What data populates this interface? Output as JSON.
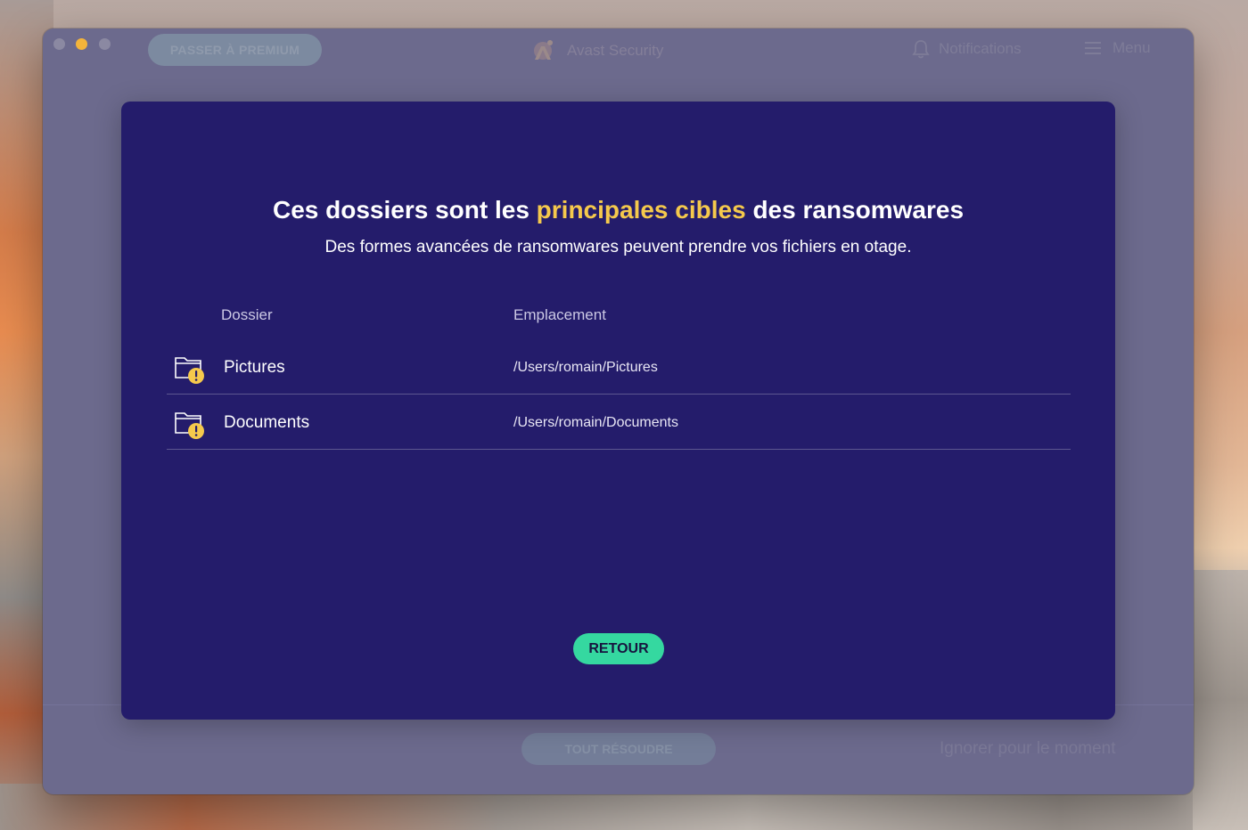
{
  "window": {
    "title": "Avast Security",
    "premium_button": "PASSER À PREMIUM",
    "notifications_label": "Notifications",
    "menu_label": "Menu",
    "resolve_all_button": "TOUT RÉSOUDRE",
    "ignore_link": "Ignorer pour le moment"
  },
  "modal": {
    "title_before": "Ces dossiers sont les ",
    "title_highlight": "principales cibles",
    "title_after": " des ransomwares",
    "subtitle": "Des formes avancées de ransomwares peuvent prendre vos fichiers en otage.",
    "columns": {
      "folder": "Dossier",
      "location": "Emplacement"
    },
    "rows": [
      {
        "name": "Pictures",
        "path": "/Users/romain/Pictures",
        "icon": "folder-warning-icon"
      },
      {
        "name": "Documents",
        "path": "/Users/romain/Documents",
        "icon": "folder-warning-icon"
      }
    ],
    "back_button": "RETOUR"
  },
  "colors": {
    "modal_bg": "#241c6b",
    "highlight": "#f5c94c",
    "accent_green": "#35d8a0",
    "warning": "#f5c94c"
  }
}
